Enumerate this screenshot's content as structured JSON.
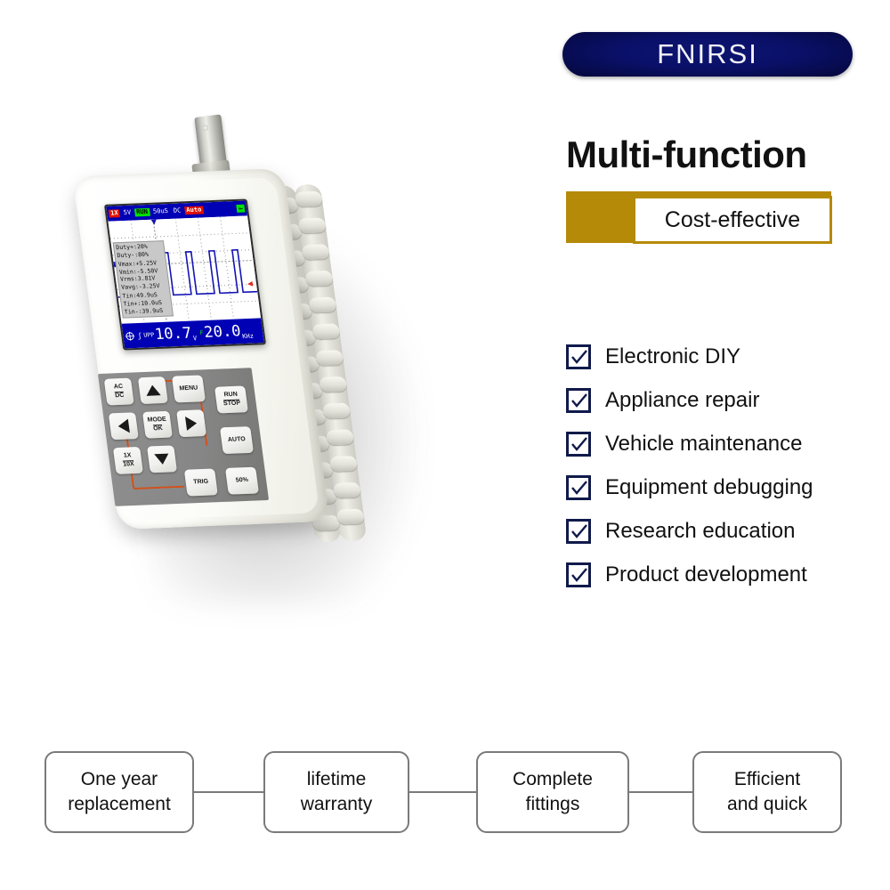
{
  "brand": {
    "name": "FNIRSI"
  },
  "headline": "Multi-function",
  "badge": {
    "text": "Cost-effective",
    "band_color": "#b58a08"
  },
  "checklist": {
    "checkbox_color": "#101a4a",
    "items": [
      {
        "label": "Electronic DIY"
      },
      {
        "label": "Appliance repair"
      },
      {
        "label": "Vehicle maintenance"
      },
      {
        "label": "Equipment debugging"
      },
      {
        "label": "Research education"
      },
      {
        "label": "Product development"
      }
    ]
  },
  "features": [
    {
      "line1": "One year",
      "line2": "replacement"
    },
    {
      "line1": "lifetime",
      "line2": "warranty"
    },
    {
      "line1": "Complete",
      "line2": "fittings"
    },
    {
      "line1": "Efficient",
      "line2": "and quick"
    }
  ],
  "device": {
    "type": "handheld-oscilloscope",
    "body_color": "#fdfdf8",
    "keypad_color": "#878785",
    "dpad_outline_color": "#d3501a",
    "screen": {
      "status_bar": {
        "probe": "1X",
        "volts_div": "5V",
        "run_state": "RUN",
        "time_div": "50uS",
        "coupling": "DC",
        "trigger_mode": "Auto",
        "back_arrow": "←",
        "bar_color": "#0000b4",
        "probe_color": "#e01000",
        "run_color": "#00e000",
        "trigger_color": "#e01000"
      },
      "measurements": [
        "Duty+:20%",
        "Duty-:80%",
        "Vmax:+5.25V",
        "Vmin:-5.50V",
        "Vrms:3.81V",
        "Vavg:-3.25V",
        "Tin:49.9uS",
        "Tin+:10.0uS",
        "Tin-:39.9uS"
      ],
      "readout": {
        "xy_icon": "crosshair-icon",
        "wave_symbol": "ʃ",
        "vpp_label": "UPP",
        "vpp_value": "10.7",
        "vpp_unit": "V",
        "freq_label": "F",
        "freq_value": "20.0",
        "freq_unit": "KHz"
      },
      "waveform": {
        "type": "square",
        "trace_color": "#1414b4",
        "duty_percent": 20,
        "pulses": 5
      }
    },
    "keys": [
      {
        "name": "ac-dc",
        "line1": "AC",
        "line2": "DC"
      },
      {
        "name": "x1-x10",
        "line1": "1X",
        "line2": "10X"
      },
      {
        "name": "mode-ok",
        "line1": "MODE",
        "line2": "OK"
      },
      {
        "name": "menu",
        "line1": "MENU",
        "line2": ""
      },
      {
        "name": "trig",
        "line1": "TRIG",
        "line2": ""
      },
      {
        "name": "run-stop",
        "line1": "RUN",
        "line2": "STOP"
      },
      {
        "name": "auto",
        "line1": "AUTO",
        "line2": ""
      },
      {
        "name": "fifty",
        "line1": "50%",
        "line2": ""
      }
    ]
  }
}
